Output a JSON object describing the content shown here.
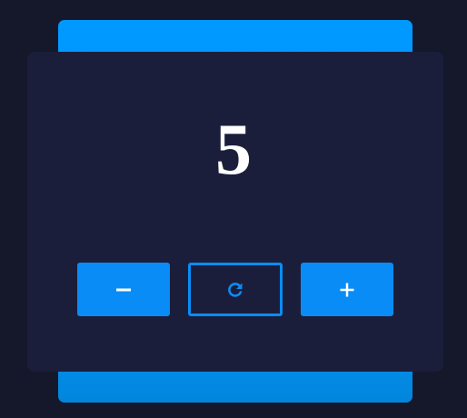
{
  "counter": {
    "value": "5"
  },
  "controls": {
    "decrement_icon": "minus-icon",
    "reset_icon": "refresh-icon",
    "increment_icon": "plus-icon"
  },
  "colors": {
    "background": "#15172b",
    "card": "#1b1e3b",
    "accent": "#0099ff",
    "button": "#0a8cf6",
    "text": "#ffffff"
  }
}
